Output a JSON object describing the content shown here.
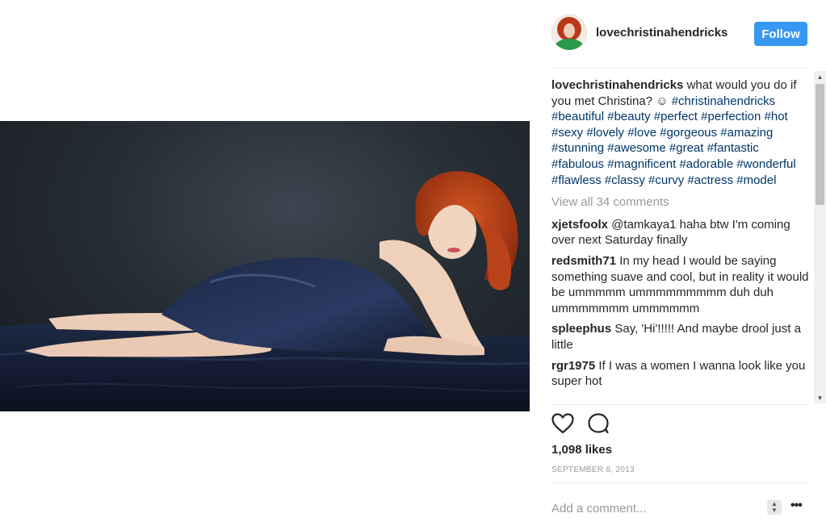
{
  "post": {
    "username": "lovechristinahendricks",
    "follow_label": "Follow",
    "caption_text": " what would you do if you met Christina? ☺ ",
    "hashtags": "#christinahendricks #beautiful #beauty #perfect #perfection #hot #sexy #lovely #love #gorgeous #amazing #stunning #awesome #great #fantastic #fabulous #magnificent #adorable #wonderful #flawless #classy #curvy #actress #model",
    "view_all_comments": "View all 34 comments",
    "likes": "1,098 likes",
    "date": "SEPTEMBER 8, 2013",
    "add_comment_placeholder": "Add a comment...",
    "more_options": "•••"
  },
  "comments": [
    {
      "user": "xjetsfoolx",
      "text": " @tamkaya1 haha btw I'm coming over next Saturday finally"
    },
    {
      "user": "redsmith71",
      "text": " In my head I would be saying something suave and cool, but in reality it would be ummmmm ummmmmmmmm duh duh ummmmmmm ummmmmm"
    },
    {
      "user": "spleephus",
      "text": " Say, 'Hi'!!!!! And maybe drool just a little"
    },
    {
      "user": "rgr1975",
      "text": " If I was a women I wanna look like you super hot"
    }
  ],
  "icons": {
    "like": "heart-icon",
    "comment": "comment-bubble-icon",
    "scroll_up": "▲",
    "scroll_down": "▼",
    "spinner_up": "▲",
    "spinner_down": "▼"
  },
  "colors": {
    "follow_button": "#3897f0",
    "hashtag": "#003569",
    "muted": "#999999"
  }
}
